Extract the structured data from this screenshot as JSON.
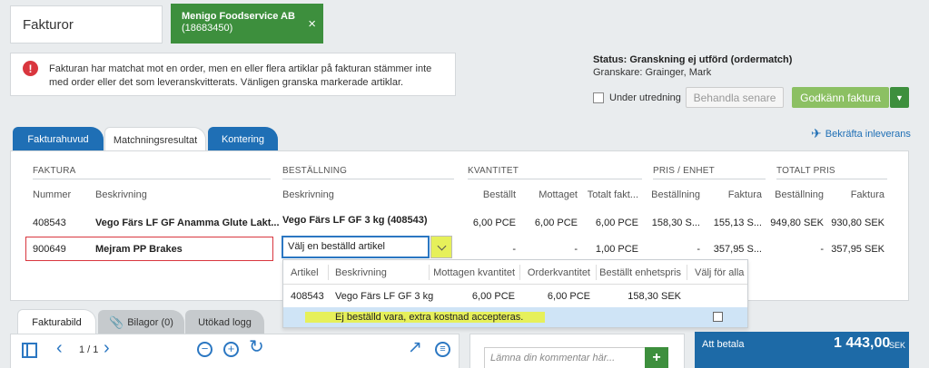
{
  "header": {
    "title": "Fakturor",
    "supplier_name": "Menigo Foodservice AB",
    "supplier_id": "(18683450)",
    "close_symbol": "×"
  },
  "alert": {
    "icon": "exclamation-icon",
    "line1": "Fakturan har matchat mot en order, men en eller flera artiklar på fakturan stämmer inte",
    "line2": "med order eller det som leveranskvitterats. Vänligen granska markerade artiklar."
  },
  "status": {
    "title": "Status: Granskning ej utförd (ordermatch)",
    "reviewer": "Granskare: Grainger, Mark"
  },
  "actions": {
    "under_investigation": "Under utredning",
    "handle_later": "Behandla senare",
    "approve": "Godkänn faktura",
    "confirm_delivery": "Bekräfta inleverans"
  },
  "tabs": [
    "Fakturahuvud",
    "Matchningsresultat",
    "Kontering"
  ],
  "table": {
    "groups": {
      "faktura": "FAKTURA",
      "bestallning": "BESTÄLLNING",
      "kvantitet": "KVANTITET",
      "pris": "PRIS / ENHET",
      "totalt": "TOTALT PRIS"
    },
    "subheaders": {
      "nummer": "Nummer",
      "beskrivning": "Beskrivning",
      "order_beskrivning": "Beskrivning",
      "bestallt": "Beställt",
      "mottaget": "Mottaget",
      "totalt_fakt": "Totalt fakt...",
      "pris_bestallning": "Beställning",
      "pris_faktura": "Faktura",
      "tot_bestallning": "Beställning",
      "tot_faktura": "Faktura"
    },
    "rows": [
      {
        "nummer": "408543",
        "beskrivning": "Vego Färs LF GF Anamma Glute Lakt...",
        "order": "Vego Färs LF GF 3 kg (408543)",
        "bestallt": "6,00 PCE",
        "mottaget": "6,00 PCE",
        "totalt_fakt": "6,00 PCE",
        "pris_bestallning": "158,30 S...",
        "pris_faktura": "155,13 S...",
        "tot_bestallning": "949,80 SEK",
        "tot_faktura": "930,80 SEK"
      },
      {
        "nummer": "900649",
        "beskrivning": "Mejram PP Brakes",
        "order_placeholder": "Välj en beställd artikel",
        "bestallt": "-",
        "mottaget": "-",
        "totalt_fakt": "1,00 PCE",
        "pris_bestallning": "-",
        "pris_faktura": "357,95 S...",
        "tot_bestallning": "-",
        "tot_faktura": "357,95 SEK"
      }
    ]
  },
  "dropdown": {
    "headers": {
      "artikel": "Artikel",
      "beskrivning": "Beskrivning",
      "mottagen": "Mottagen kvantitet",
      "order": "Orderkvantitet",
      "pris": "Beställt enhetspris",
      "valj": "Välj för alla"
    },
    "item": {
      "artikel": "408543",
      "beskrivning": "Vego Färs LF GF 3 kg",
      "mottagen": "6,00 PCE",
      "order": "6,00 PCE",
      "pris": "158,30 SEK"
    },
    "extra_cost": "Ej beställd vara, extra kostnad accepteras."
  },
  "bottom_tabs": [
    "Fakturabild",
    "Bilagor (0)",
    "Utökad logg"
  ],
  "viewer": {
    "page": "1 / 1"
  },
  "comment": {
    "placeholder": "Lämna din kommentar här...",
    "add": "+"
  },
  "summary": {
    "label": "Att betala",
    "amount": "1 443,00",
    "currency": "SEK"
  },
  "colors": {
    "green": "#3d8f3d",
    "blue_tab": "#1f6fb5",
    "approve": "#8cc063",
    "highlight": "#e6f05a",
    "pay_panel": "#1d6aa7"
  }
}
